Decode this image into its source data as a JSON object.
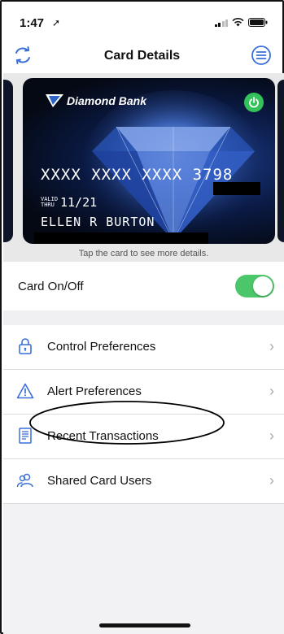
{
  "status_bar": {
    "time": "1:47",
    "location_glyph": "➚"
  },
  "nav": {
    "title": "Card Details",
    "left_icon": "refresh-icon",
    "right_icon": "menu-icon"
  },
  "card": {
    "bank_name": "Diamond Bank",
    "number": "XXXX XXXX XXXX 3798",
    "valid_label_line1": "VALID",
    "valid_label_line2": "THRU",
    "expiry": "11/21",
    "holder": "ELLEN R BURTON",
    "hint": "Tap the card to see more details."
  },
  "toggle": {
    "label": "Card On/Off",
    "on": true,
    "color": "#4cc66a"
  },
  "menu_items": [
    {
      "label": "Control Preferences",
      "icon": "lock-icon"
    },
    {
      "label": "Alert Preferences",
      "icon": "alert-icon"
    },
    {
      "label": "Recent Transactions",
      "icon": "receipt-icon"
    },
    {
      "label": "Shared Card Users",
      "icon": "users-icon"
    }
  ],
  "colors": {
    "accent": "#3a6fd8",
    "toggle_on": "#4cc66a",
    "card_bg": "#0a1a44"
  }
}
